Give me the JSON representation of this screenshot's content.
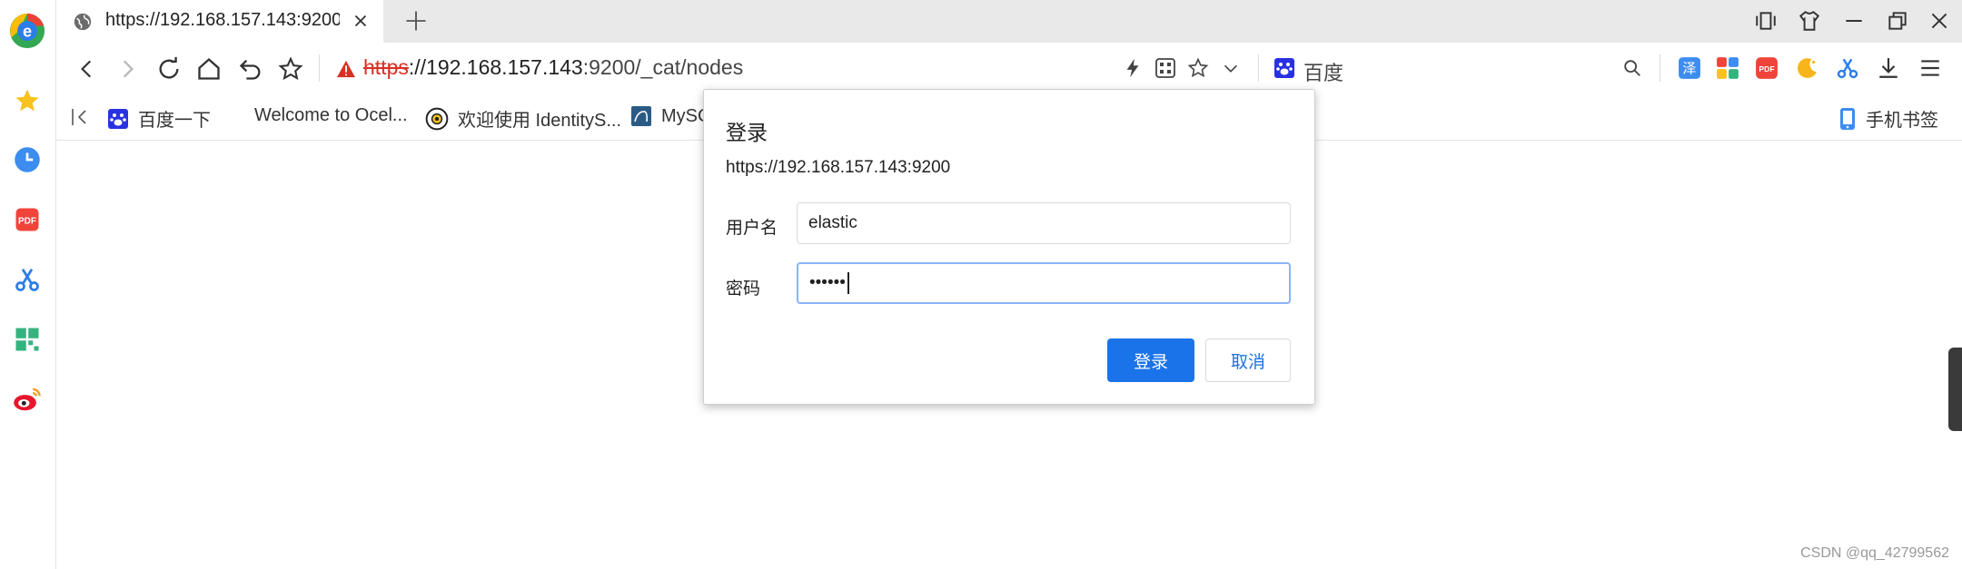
{
  "tab": {
    "title": "https://192.168.157.143:9200/",
    "new_tab_icon": "plus-icon",
    "close_icon": "close-icon"
  },
  "address_bar": {
    "scheme": "https",
    "rest": "://192.168.157.143",
    "port_path": ":9200/_cat/nodes",
    "security_icon": "warning-icon"
  },
  "search_engine": {
    "label": "百度",
    "icon": "baidu-paw-icon"
  },
  "bookmarks": [
    {
      "label": "百度一下",
      "icon": "baidu-paw-icon"
    },
    {
      "label": "Welcome to Ocel...",
      "icon": ""
    },
    {
      "label": "欢迎使用 IdentityS...",
      "icon": "identity-icon"
    },
    {
      "label": "MySC",
      "icon": "mysql-icon"
    }
  ],
  "mobile_bookmarks": {
    "label": "手机书签",
    "icon": "phone-icon"
  },
  "dialog": {
    "title": "登录",
    "origin": "https://192.168.157.143:9200",
    "username_label": "用户名",
    "username_value": "elastic",
    "password_label": "密码",
    "password_value": "••••••",
    "login_button": "登录",
    "cancel_button": "取消"
  },
  "extensions": [
    "translate-icon",
    "apps-icon",
    "pdf-icon",
    "moon-icon",
    "scissors-icon"
  ],
  "sidebar_icons": [
    "browser-logo-icon",
    "star-icon",
    "clock-icon",
    "pdf-icon",
    "scissors-icon",
    "apps-icon",
    "weibo-icon"
  ],
  "watermark": "CSDN @qq_42799562",
  "colors": {
    "accent": "#1a73e8",
    "warning": "#d93025",
    "baidu": "#2932e1"
  }
}
